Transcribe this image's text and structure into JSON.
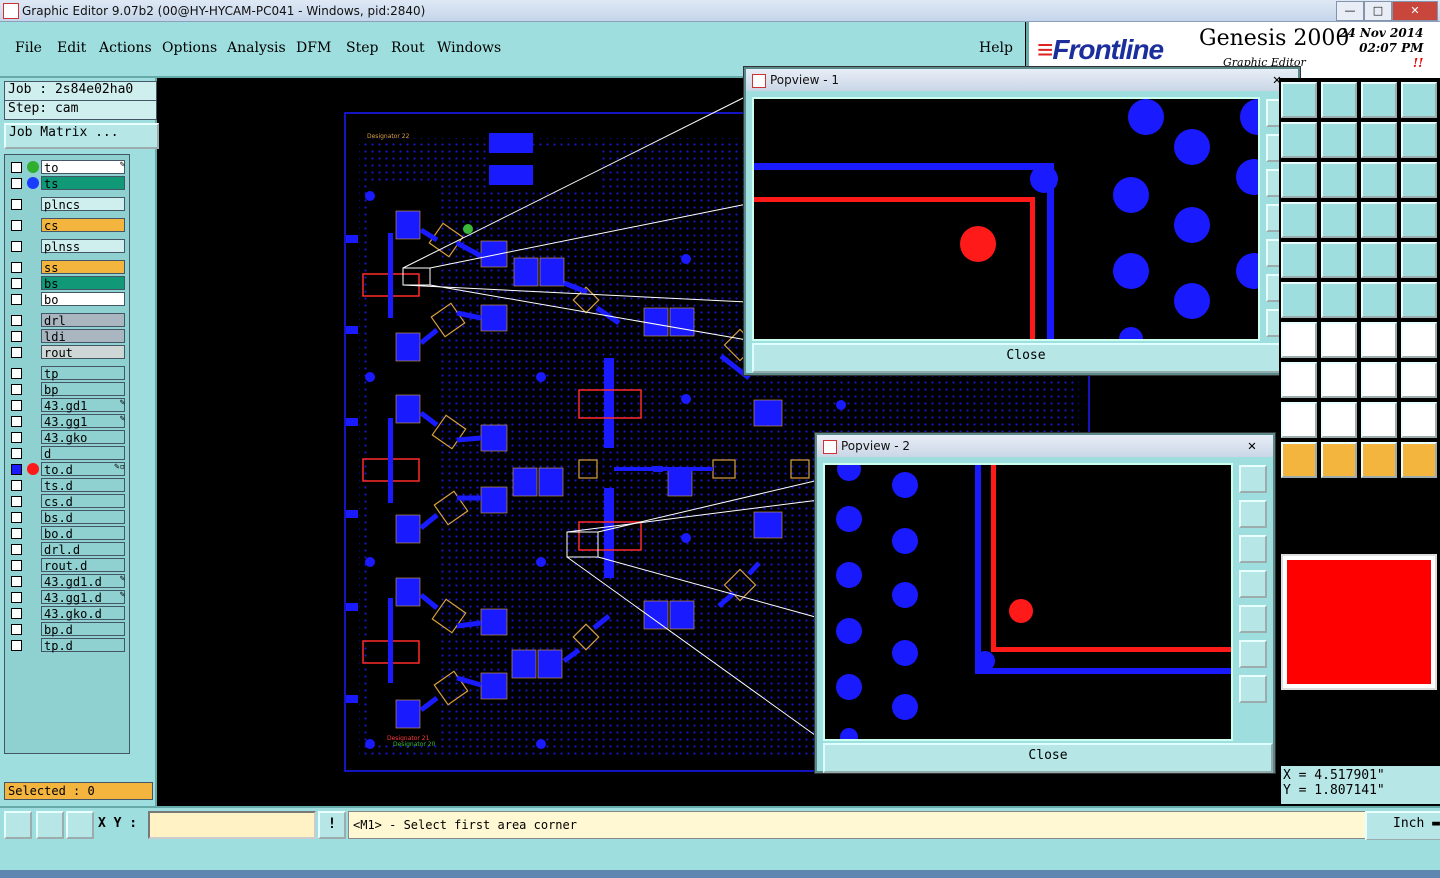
{
  "window": {
    "title": "Graphic Editor 9.07b2 (00@HY-HYCAM-PC041 - Windows, pid:2840)",
    "min": "—",
    "max": "□",
    "close": "✕"
  },
  "menu": [
    "File",
    "Edit",
    "Actions",
    "Options",
    "Analysis",
    "DFM",
    "Step",
    "Rout",
    "Windows",
    "Help"
  ],
  "brand": {
    "logo_prefix": "≡",
    "logo": "Frontline",
    "product": "Genesis 2000",
    "subtitle": "Graphic Editor",
    "date": "24 Nov 2014",
    "time": "02:07 PM",
    "alert": "!!"
  },
  "left": {
    "job": "Job  : 2s84e02ha0",
    "step": "Step: cam",
    "job_matrix": "Job Matrix ...",
    "selected": "Selected : 0"
  },
  "layers": [
    {
      "name": "to",
      "bg": "#ffffff",
      "dot": "#2fae2f",
      "mark": "✎"
    },
    {
      "name": "ts",
      "bg": "#119877",
      "dot": "#1a3cff"
    },
    {
      "name": "plncs",
      "bg": "#cfeeee"
    },
    {
      "name": "cs",
      "bg": "#f4b53f"
    },
    {
      "name": "plnss",
      "bg": "#cfeeee"
    },
    {
      "name": "ss",
      "bg": "#f4b53f"
    },
    {
      "name": "bs",
      "bg": "#119877"
    },
    {
      "name": "bo",
      "bg": "#ffffff"
    },
    {
      "name": "drl",
      "bg": "#a9b6c0"
    },
    {
      "name": "ldi",
      "bg": "#a9b6c0"
    },
    {
      "name": "rout",
      "bg": "#cfd6d6"
    },
    {
      "name": "tp",
      "bg": "#8fd0d0"
    },
    {
      "name": "bp",
      "bg": "#8fd0d0"
    },
    {
      "name": "43.gd1",
      "bg": "#8fd0d0",
      "mark": "✎"
    },
    {
      "name": "43.gg1",
      "bg": "#8fd0d0",
      "mark": "✎"
    },
    {
      "name": "43.gko",
      "bg": "#8fd0d0"
    },
    {
      "name": "d",
      "bg": "#8fd0d0"
    },
    {
      "name": "to.d",
      "bg": "#8fd0d0",
      "dot": "#ff1a1a",
      "mark": "✎▫"
    },
    {
      "name": "ts.d",
      "bg": "#8fd0d0"
    },
    {
      "name": "cs.d",
      "bg": "#8fd0d0"
    },
    {
      "name": "bs.d",
      "bg": "#8fd0d0"
    },
    {
      "name": "bo.d",
      "bg": "#8fd0d0"
    },
    {
      "name": "drl.d",
      "bg": "#8fd0d0"
    },
    {
      "name": "rout.d",
      "bg": "#8fd0d0"
    },
    {
      "name": "43.gd1.d",
      "bg": "#8fd0d0",
      "mark": "✎"
    },
    {
      "name": "43.gg1.d",
      "bg": "#8fd0d0",
      "mark": "✎"
    },
    {
      "name": "43.gko.d",
      "bg": "#8fd0d0"
    },
    {
      "name": "bp.d",
      "bg": "#8fd0d0"
    },
    {
      "name": "tp.d",
      "bg": "#8fd0d0"
    }
  ],
  "board_labels": {
    "designator_top": "Designator 22",
    "designator_bottom_1": "Designator 21",
    "designator_bottom_2": "Designator 20"
  },
  "popview1": {
    "title": "Popview - 1",
    "close": "Close"
  },
  "popview2": {
    "title": "Popview - 2",
    "close": "Close"
  },
  "coords": {
    "x": "X = 4.517901\"",
    "y": "Y = 1.807141\""
  },
  "bottom": {
    "xy_label": "X Y :",
    "xy_value": "",
    "prompt": "<M1> - Select first area corner",
    "unit": "Inch",
    "alert": "!"
  },
  "colors": {
    "pad": "#1a1aff",
    "trace_red": "#ff1a1a",
    "panel": "#9fdede",
    "highlight": "#ff0000"
  }
}
